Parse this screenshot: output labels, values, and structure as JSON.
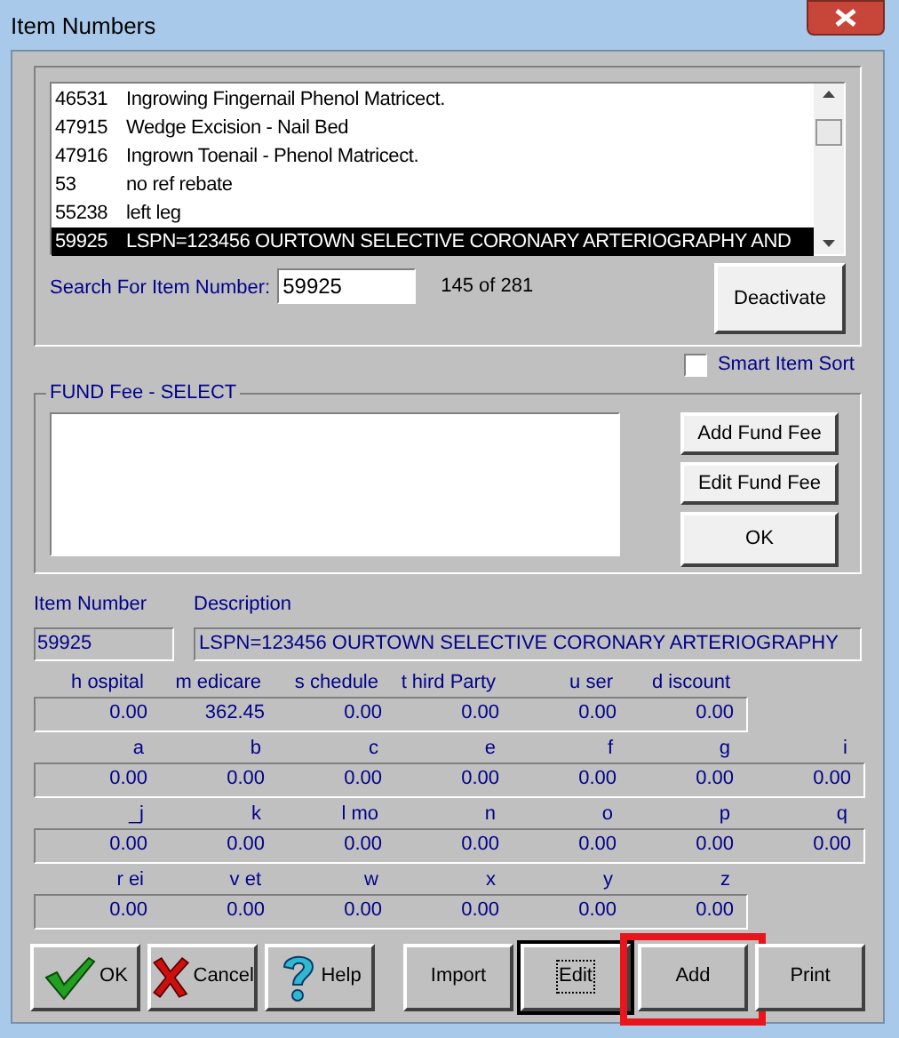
{
  "window": {
    "title": "Item Numbers"
  },
  "item_list": [
    {
      "number": "46531",
      "description": "Ingrowing Fingernail Phenol Matricect.",
      "selected": false
    },
    {
      "number": "47915",
      "description": "Wedge Excision - Nail Bed",
      "selected": false
    },
    {
      "number": "47916",
      "description": "Ingrown Toenail - Phenol Matricect.",
      "selected": false
    },
    {
      "number": "53",
      "description": "no ref rebate",
      "selected": false
    },
    {
      "number": "55238",
      "description": "left leg",
      "selected": false
    },
    {
      "number": "59925",
      "description": "LSPN=123456 OURTOWN SELECTIVE CORONARY ARTERIOGRAPHY AND",
      "selected": true
    }
  ],
  "search": {
    "label": "Search For Item Number:",
    "value": "59925",
    "count": "145 of 281"
  },
  "deactivate_button": "Deactivate",
  "smart_item_sort": {
    "label": "Smart Item Sort",
    "checked": false
  },
  "fund_fee": {
    "title": "FUND Fee - SELECT",
    "buttons": [
      "Add Fund Fee",
      "Edit Fund Fee",
      "OK"
    ]
  },
  "item_number": {
    "label": "Item Number",
    "value": "59925"
  },
  "description": {
    "label": "Description",
    "value": "LSPN=123456 OURTOWN SELECTIVE CORONARY ARTERIOGRAPHY"
  },
  "fee_rows": [
    [
      {
        "label": "h ospital",
        "value": "0.00"
      },
      {
        "label": "m edicare",
        "value": "362.45"
      },
      {
        "label": "s chedule",
        "value": "0.00"
      },
      {
        "label": "t hird Party",
        "value": "0.00"
      },
      {
        "label": "u ser",
        "value": "0.00"
      },
      {
        "label": "d iscount",
        "value": "0.00"
      }
    ],
    [
      {
        "label": "a",
        "value": "0.00"
      },
      {
        "label": "b",
        "value": "0.00"
      },
      {
        "label": "c",
        "value": "0.00"
      },
      {
        "label": "e",
        "value": "0.00"
      },
      {
        "label": "f",
        "value": "0.00"
      },
      {
        "label": "g",
        "value": "0.00"
      },
      {
        "label": "i",
        "value": "0.00"
      }
    ],
    [
      {
        "label": "_j",
        "value": "0.00"
      },
      {
        "label": "k",
        "value": "0.00"
      },
      {
        "label": "l mo",
        "value": "0.00"
      },
      {
        "label": "n",
        "value": "0.00"
      },
      {
        "label": "o",
        "value": "0.00"
      },
      {
        "label": "p",
        "value": "0.00"
      },
      {
        "label": "q",
        "value": "0.00"
      }
    ],
    [
      {
        "label": "r ei",
        "value": "0.00"
      },
      {
        "label": "v et",
        "value": "0.00"
      },
      {
        "label": "w",
        "value": "0.00"
      },
      {
        "label": "x",
        "value": "0.00"
      },
      {
        "label": "y",
        "value": "0.00"
      },
      {
        "label": "z",
        "value": "0.00"
      }
    ]
  ],
  "buttons": [
    {
      "label": "OK",
      "kind": "ok",
      "focused": false,
      "highlighted": false
    },
    {
      "label": "Cancel",
      "kind": "cancel",
      "focused": false,
      "highlighted": false
    },
    {
      "label": "Help",
      "kind": "help",
      "focused": false,
      "highlighted": false
    },
    {
      "label": "Import",
      "kind": "plain",
      "focused": false,
      "highlighted": false
    },
    {
      "label": "Edit",
      "kind": "plain",
      "focused": true,
      "highlighted": false
    },
    {
      "label": "Add",
      "kind": "plain",
      "focused": false,
      "highlighted": true
    },
    {
      "label": "Print",
      "kind": "plain",
      "focused": false,
      "highlighted": false
    }
  ]
}
